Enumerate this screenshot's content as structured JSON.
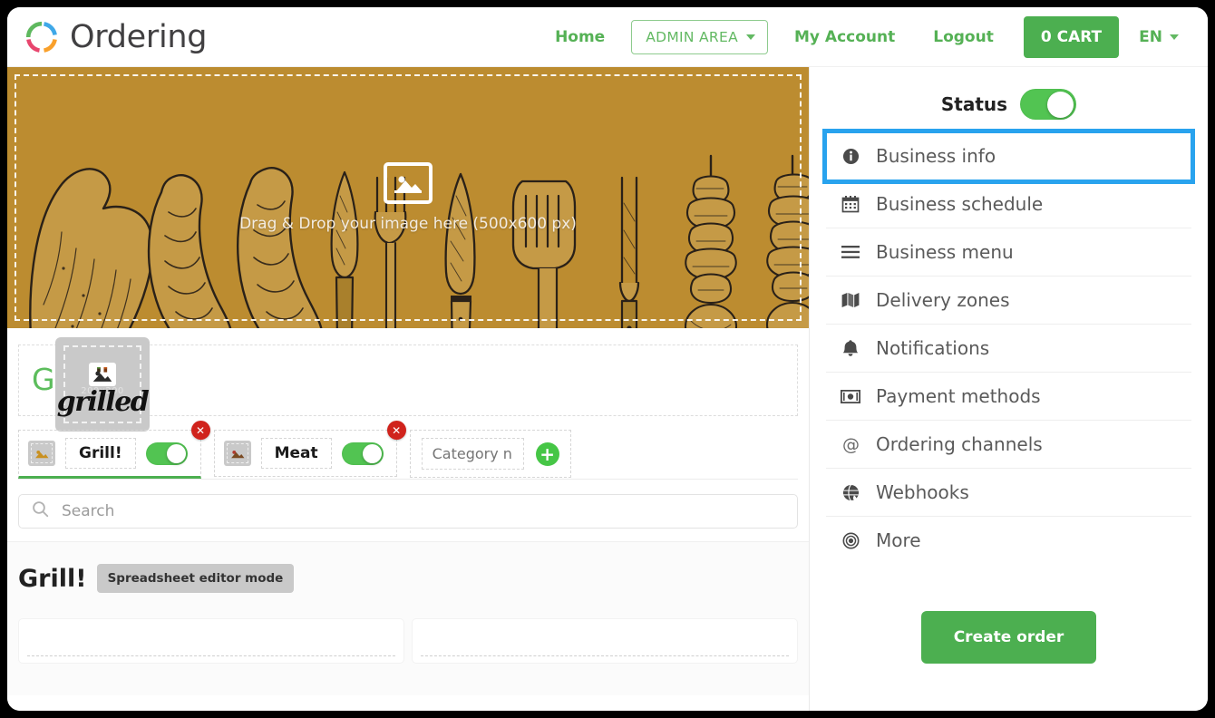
{
  "navbar": {
    "brand": "Ordering",
    "brand_icon": "ordering-ring-logo",
    "home": "Home",
    "admin_area": "ADMIN AREA",
    "my_account": "My Account",
    "logout": "Logout",
    "cart": "0 CART",
    "language": "EN",
    "colors": {
      "green": "#55b155",
      "cart_green": "#4caf50"
    }
  },
  "banner": {
    "drop_text": "Drag & Drop your image here (500x600 px)",
    "drop_icon": "image-placeholder-icon",
    "background_color": "#bc8c30",
    "logo_thumb": {
      "word": "grilled",
      "size_hint": "200x200",
      "icon": "image-placeholder-icon"
    }
  },
  "business": {
    "title": "Grilled"
  },
  "categories": {
    "tabs": [
      {
        "name": "Grill!",
        "enabled": true,
        "active": true,
        "delete_icon": "✕"
      },
      {
        "name": "Meat",
        "enabled": true,
        "active": false,
        "delete_icon": "✕"
      }
    ],
    "new_category_placeholder": "Category na",
    "add_icon": "+"
  },
  "search": {
    "placeholder": "Search",
    "icon": "search-icon"
  },
  "products_section": {
    "title": "Grill!",
    "mode_chip": "Spreadsheet editor mode"
  },
  "sidebar": {
    "status_label": "Status",
    "status_on": true,
    "items": [
      {
        "label": "Business info",
        "icon": "info-circle-icon",
        "highlighted": true
      },
      {
        "label": "Business schedule",
        "icon": "calendar-icon",
        "highlighted": false
      },
      {
        "label": "Business menu",
        "icon": "hamburger-lines-icon",
        "highlighted": false
      },
      {
        "label": "Delivery zones",
        "icon": "map-icon",
        "highlighted": false
      },
      {
        "label": "Notifications",
        "icon": "bell-icon",
        "highlighted": false
      },
      {
        "label": "Payment methods",
        "icon": "money-bill-icon",
        "highlighted": false
      },
      {
        "label": "Ordering channels",
        "icon": "at-sign-icon",
        "highlighted": false
      },
      {
        "label": "Webhooks",
        "icon": "globe-icon",
        "highlighted": false
      },
      {
        "label": "More",
        "icon": "target-circle-icon",
        "highlighted": false
      }
    ],
    "create_order": "Create order",
    "highlight_color": "#29a3ee"
  }
}
